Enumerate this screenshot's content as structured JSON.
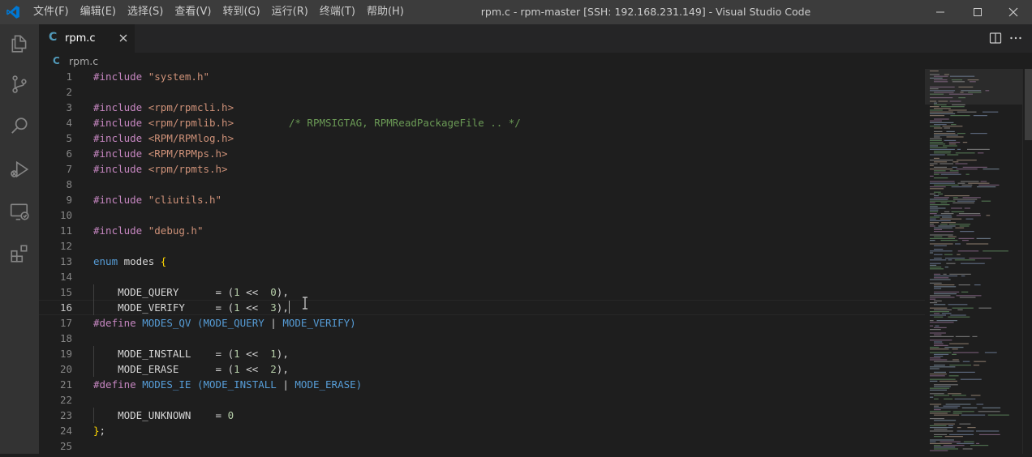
{
  "window": {
    "title": "rpm.c - rpm-master [SSH: 192.168.231.149] - Visual Studio Code",
    "menu": [
      "文件(F)",
      "编辑(E)",
      "选择(S)",
      "查看(V)",
      "转到(G)",
      "运行(R)",
      "终端(T)",
      "帮助(H)"
    ]
  },
  "activity_bar": [
    "explorer-icon",
    "source-control-icon",
    "search-icon",
    "run-debug-icon",
    "remote-explorer-icon",
    "extensions-icon"
  ],
  "tab": {
    "icon_text": "C",
    "label": "rpm.c"
  },
  "breadcrumb": {
    "icon_text": "C",
    "label": "rpm.c"
  },
  "editor": {
    "active_line": 16,
    "lines": [
      {
        "n": "1",
        "text": "#include \"system.h\""
      },
      {
        "n": "2",
        "text": ""
      },
      {
        "n": "3",
        "text": "#include <rpm/rpmcli.h>"
      },
      {
        "n": "4",
        "text": "#include <rpm/rpmlib.h>         /* RPMSIGTAG, RPMReadPackageFile .. */"
      },
      {
        "n": "5",
        "text": "#include <RPM/RPMlog.h>"
      },
      {
        "n": "6",
        "text": "#include <RPM/RPMps.h>"
      },
      {
        "n": "7",
        "text": "#include <rpm/rpmts.h>"
      },
      {
        "n": "8",
        "text": ""
      },
      {
        "n": "9",
        "text": "#include \"cliutils.h\""
      },
      {
        "n": "10",
        "text": ""
      },
      {
        "n": "11",
        "text": "#include \"debug.h\""
      },
      {
        "n": "12",
        "text": ""
      },
      {
        "n": "13",
        "text": "enum modes {"
      },
      {
        "n": "14",
        "text": ""
      },
      {
        "n": "15",
        "text": "    MODE_QUERY      = (1 <<  0),"
      },
      {
        "n": "16",
        "text": "    MODE_VERIFY     = (1 <<  3),"
      },
      {
        "n": "17",
        "text": "#define MODES_QV (MODE_QUERY | MODE_VERIFY)"
      },
      {
        "n": "18",
        "text": ""
      },
      {
        "n": "19",
        "text": "    MODE_INSTALL    = (1 <<  1),"
      },
      {
        "n": "20",
        "text": "    MODE_ERASE      = (1 <<  2),"
      },
      {
        "n": "21",
        "text": "#define MODES_IE (MODE_INSTALL | MODE_ERASE)"
      },
      {
        "n": "22",
        "text": ""
      },
      {
        "n": "23",
        "text": "    MODE_UNKNOWN    = 0"
      },
      {
        "n": "24",
        "text": "};"
      },
      {
        "n": "25",
        "text": ""
      }
    ]
  },
  "colors": {
    "titlebar": "#3c3c3c",
    "activitybar": "#333333",
    "editor_bg": "#1e1e1e",
    "keyword_directive": "#c586c0",
    "keyword": "#569cd6",
    "string": "#ce9178",
    "comment": "#6a9955",
    "number": "#b5cea8",
    "bracket": "#ffd700",
    "vscode_blue": "#0078d4"
  }
}
